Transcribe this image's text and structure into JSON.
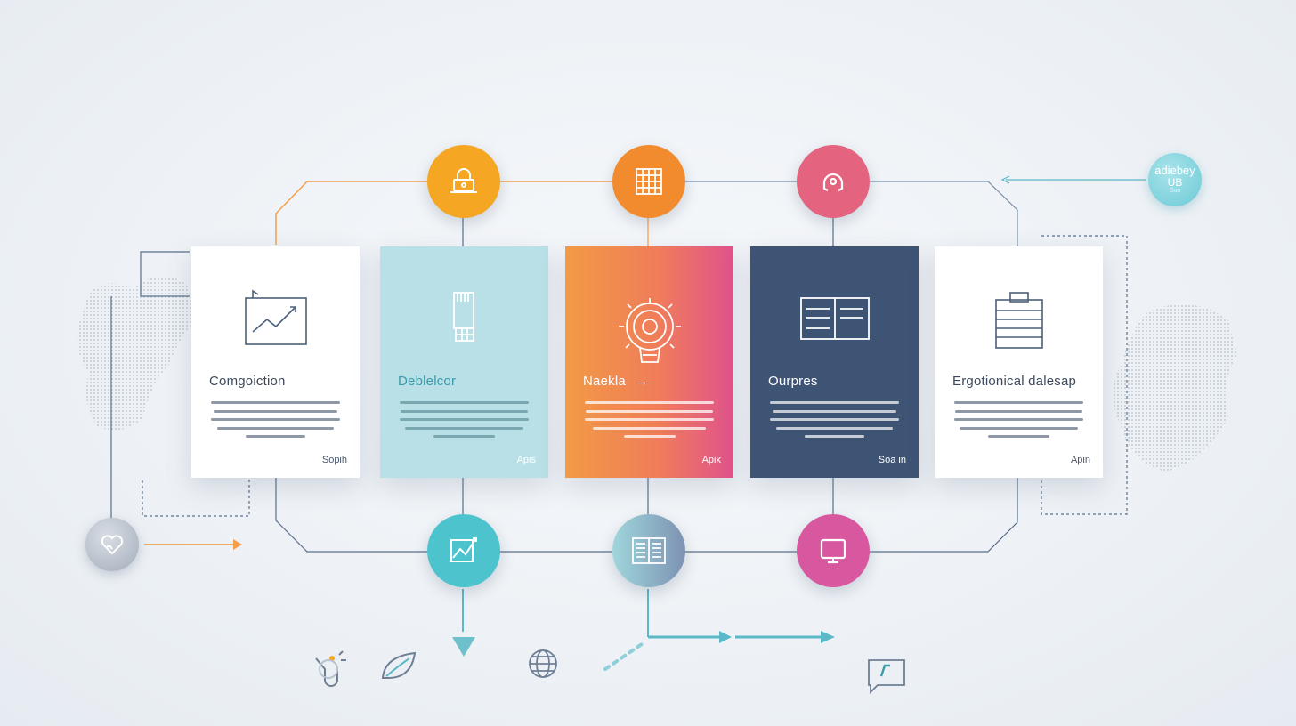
{
  "colors": {
    "orange": "#f4a12a",
    "teal": "#5bc6cf",
    "pink": "#e0528c",
    "navy": "#3e5475",
    "light_blue": "#b9e0e6",
    "connector": "#7a8ea6",
    "arrow_teal": "#5ab8c7",
    "arrow_orange": "#f2a04d"
  },
  "cards": [
    {
      "title": "Comgoiction",
      "footer": "Sopih",
      "icon": "line-chart-icon"
    },
    {
      "title": "Deblelcor",
      "footer": "Apis",
      "icon": "server-device-icon"
    },
    {
      "title": "Naekla",
      "footer": "Apik",
      "icon": "lightbulb-gear-icon"
    },
    {
      "title": "Ourpres",
      "footer": "Soa in",
      "icon": "open-book-icon"
    },
    {
      "title": "Ergotionical dalesap",
      "footer": "Apin",
      "icon": "clipboard-list-icon"
    }
  ],
  "top_nodes": [
    {
      "icon": "laptop-lock-icon"
    },
    {
      "icon": "grid-calendar-icon"
    },
    {
      "icon": "headset-icon"
    }
  ],
  "bottom_nodes": [
    {
      "icon": "chart-board-icon"
    },
    {
      "icon": "book-icon"
    },
    {
      "icon": "monitor-icon"
    }
  ],
  "top_right_badge": {
    "line1": "adiebey",
    "line2": "UB",
    "line3": "Sun"
  },
  "left_node": {
    "icon": "heart-hand-icon"
  },
  "footer_icons": [
    "hand-touch-icon",
    "leaf-icon",
    "brush-icon",
    "globe-icon",
    "chat-check-icon"
  ]
}
